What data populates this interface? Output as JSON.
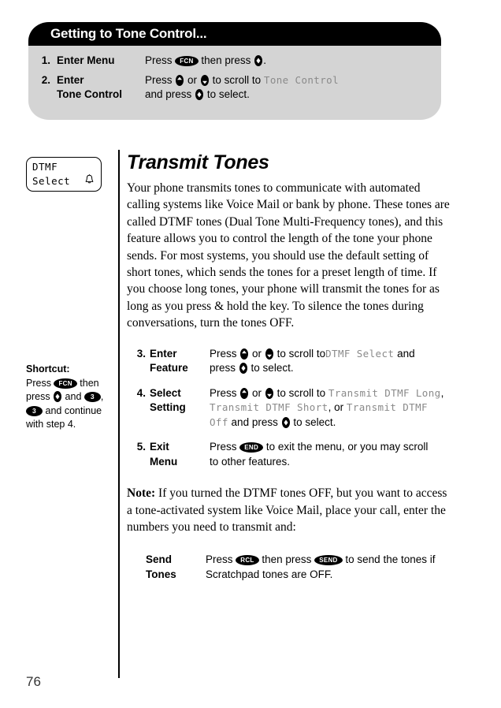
{
  "callout": {
    "title": "Getting to Tone Control...",
    "steps": [
      {
        "num": "1.",
        "name": "Enter Menu",
        "desc_parts": [
          "Press ",
          "FCN",
          " then press ",
          "SELECT",
          "."
        ]
      },
      {
        "num": "2.",
        "name": "Enter Tone Control",
        "name_line1": "Enter",
        "name_line2": "Tone Control",
        "desc_parts": [
          "Press ",
          "UP",
          " or ",
          "DOWN",
          " to scroll to ",
          "Tone Control",
          " and press ",
          "SELECT",
          " to select."
        ]
      }
    ]
  },
  "phone_display": {
    "line1": "DTMF",
    "line2": "Select",
    "indicator_icon": "bell-icon"
  },
  "shortcut": {
    "title": "Shortcut:",
    "text_parts": [
      "Press ",
      "FCN",
      " then press ",
      "SELECT",
      " and ",
      "3",
      ", ",
      "3",
      " and continue with step 4."
    ],
    "keys": [
      "FCN",
      "3",
      "3"
    ],
    "step_reference": "step 4."
  },
  "main": {
    "title": "Transmit Tones",
    "intro": "Your phone transmits tones to communicate with automated calling systems like Voice Mail or bank by phone. These tones are called DTMF tones (Dual Tone Multi-Frequency tones), and this feature allows you to control the length of the tone your phone sends. For most systems, you should use the default setting of short tones, which sends the tones for a preset length of time. If you choose long tones, your phone will transmit the tones for as long as you press & hold the key. To silence the tones during conversations, turn the tones OFF.",
    "steps": [
      {
        "num": "3.",
        "name_line1": "Enter",
        "name_line2": "Feature",
        "lcd_values": [
          "DTMF Select"
        ]
      },
      {
        "num": "4.",
        "name_line1": "Select",
        "name_line2": "Setting",
        "lcd_values": [
          "Transmit DTMF Long",
          "Transmit DTMF Short",
          "Transmit DTMF Off"
        ]
      },
      {
        "num": "5.",
        "name_line1": "Exit",
        "name_line2": "Menu",
        "desc": "Press END to exit the menu, or you may scroll to other features."
      }
    ],
    "note_label": "Note:",
    "note_text": "If you turned the DTMF tones OFF, but you want to access a tone-activated system like Voice Mail, place your call, enter the numbers you need to transmit and:",
    "send_tones": {
      "name_line1": "Send",
      "name_line2": "Tones",
      "desc_tail": "to send the tones if Scratchpad tones are OFF."
    }
  },
  "labels": {
    "press": "Press",
    "or": "or",
    "to_scroll_to": "to scroll to",
    "and": "and",
    "and_press": "and press",
    "to_select": "to select.",
    "press_lower": "press",
    "comma": ",",
    "or_lower": "or",
    "then_press": "then press",
    "exit_menu_tail": "to exit the menu, or you may scroll",
    "exit_menu_tail2": "to other features.",
    "send_tail": "to send the tones if",
    "send_tail2": "Scratchpad tones are OFF.",
    "period": "."
  },
  "keys": {
    "fcn": "FCN",
    "end": "END",
    "rcl": "RCL",
    "send": "SEND",
    "three": "3"
  },
  "page_number": "76",
  "colors": {
    "callout_bg": "#d4d4d4",
    "header_bg": "#000000",
    "header_text": "#ffffff",
    "lcd_text": "#8a8a8a",
    "body_text": "#000000"
  }
}
